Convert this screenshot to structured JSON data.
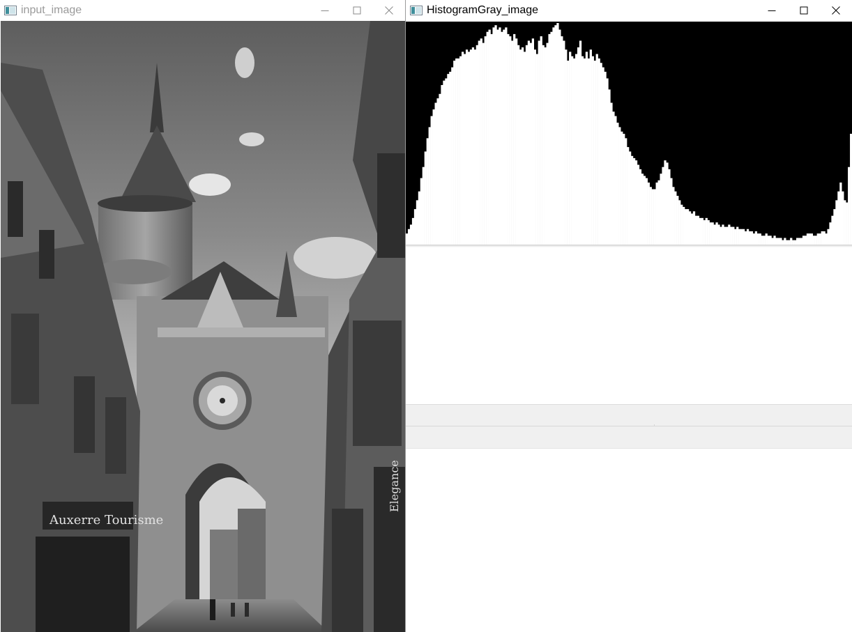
{
  "windows": {
    "input": {
      "title": "input_image",
      "active": false
    },
    "histogram": {
      "title": "HistogramGray_image",
      "active": true
    }
  },
  "controls": {
    "minimize_icon": "minimize-icon",
    "maximize_icon": "maximize-icon",
    "close_icon": "close-icon"
  },
  "photo": {
    "shop_sign": "Auxerre Tourisme",
    "right_sign": "Elegance"
  },
  "status": {
    "left": "",
    "right": ""
  },
  "histogram": {
    "bins": 256,
    "max": 1.0,
    "values": [
      0.05,
      0.07,
      0.09,
      0.12,
      0.16,
      0.2,
      0.24,
      0.3,
      0.35,
      0.42,
      0.48,
      0.53,
      0.58,
      0.61,
      0.64,
      0.66,
      0.68,
      0.72,
      0.74,
      0.75,
      0.77,
      0.78,
      0.8,
      0.83,
      0.84,
      0.84,
      0.85,
      0.87,
      0.86,
      0.88,
      0.87,
      0.88,
      0.89,
      0.88,
      0.9,
      0.92,
      0.93,
      0.91,
      0.94,
      0.96,
      0.97,
      0.95,
      0.98,
      0.99,
      0.97,
      0.98,
      0.96,
      0.97,
      0.98,
      0.95,
      0.94,
      0.92,
      0.95,
      0.93,
      0.9,
      0.88,
      0.89,
      0.87,
      0.9,
      0.92,
      0.91,
      0.93,
      0.88,
      0.86,
      0.92,
      0.94,
      0.9,
      0.89,
      0.91,
      0.95,
      0.96,
      0.98,
      0.99,
      1.0,
      0.97,
      0.94,
      0.92,
      0.88,
      0.83,
      0.87,
      0.85,
      0.84,
      0.86,
      0.89,
      0.92,
      0.85,
      0.84,
      0.87,
      0.84,
      0.88,
      0.85,
      0.83,
      0.86,
      0.84,
      0.82,
      0.8,
      0.78,
      0.75,
      0.7,
      0.64,
      0.6,
      0.58,
      0.55,
      0.53,
      0.51,
      0.5,
      0.48,
      0.44,
      0.42,
      0.4,
      0.39,
      0.38,
      0.36,
      0.34,
      0.32,
      0.31,
      0.3,
      0.28,
      0.26,
      0.25,
      0.25,
      0.28,
      0.29,
      0.32,
      0.35,
      0.38,
      0.37,
      0.34,
      0.3,
      0.26,
      0.24,
      0.22,
      0.2,
      0.18,
      0.17,
      0.16,
      0.16,
      0.15,
      0.14,
      0.15,
      0.13,
      0.13,
      0.12,
      0.12,
      0.11,
      0.12,
      0.11,
      0.1,
      0.1,
      0.09,
      0.1,
      0.09,
      0.08,
      0.09,
      0.08,
      0.08,
      0.09,
      0.08,
      0.08,
      0.07,
      0.08,
      0.07,
      0.07,
      0.07,
      0.06,
      0.07,
      0.06,
      0.06,
      0.05,
      0.06,
      0.05,
      0.05,
      0.04,
      0.04,
      0.05,
      0.04,
      0.04,
      0.03,
      0.04,
      0.03,
      0.03,
      0.03,
      0.02,
      0.03,
      0.02,
      0.02,
      0.03,
      0.02,
      0.02,
      0.03,
      0.03,
      0.03,
      0.04,
      0.04,
      0.05,
      0.05,
      0.05,
      0.04,
      0.04,
      0.05,
      0.05,
      0.06,
      0.06,
      0.05,
      0.07,
      0.1,
      0.13,
      0.16,
      0.2,
      0.24,
      0.28,
      0.24,
      0.2,
      0.19,
      0.35,
      0.5
    ]
  }
}
